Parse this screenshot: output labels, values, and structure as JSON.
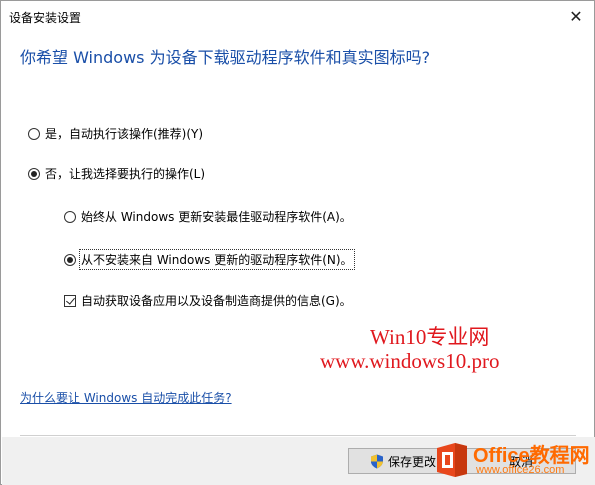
{
  "window": {
    "title": "设备安装设置",
    "close_glyph": "✕"
  },
  "heading": "你希望 Windows 为设备下载驱动程序软件和真实图标吗?",
  "options": {
    "yes": {
      "label": "是，自动执行该操作(推荐)(Y)",
      "checked": false
    },
    "no": {
      "label": "否，让我选择要执行的操作(L)",
      "checked": true
    },
    "always_update": {
      "label": "始终从 Windows 更新安装最佳驱动程序软件(A)。",
      "checked": false
    },
    "never_install": {
      "label": "从不安装来自 Windows 更新的驱动程序软件(N)。",
      "checked": true
    },
    "auto_fetch": {
      "label": "自动获取设备应用以及设备制造商提供的信息(G)。",
      "checked": true
    }
  },
  "help_link": "为什么要让 Windows 自动完成此任务?",
  "buttons": {
    "save": "保存更改",
    "cancel": "取消"
  },
  "watermark": {
    "line1": "Win10专业网",
    "line2": "www.windows10.pro",
    "color": "#e0181e"
  },
  "office_logo": {
    "text": "Office教程网",
    "url": "www.office26.com",
    "color": "#ff6a00"
  },
  "colors": {
    "heading": "#1a4fa8",
    "link": "#1a4fa8",
    "footer_bg": "#f0f0f0"
  }
}
